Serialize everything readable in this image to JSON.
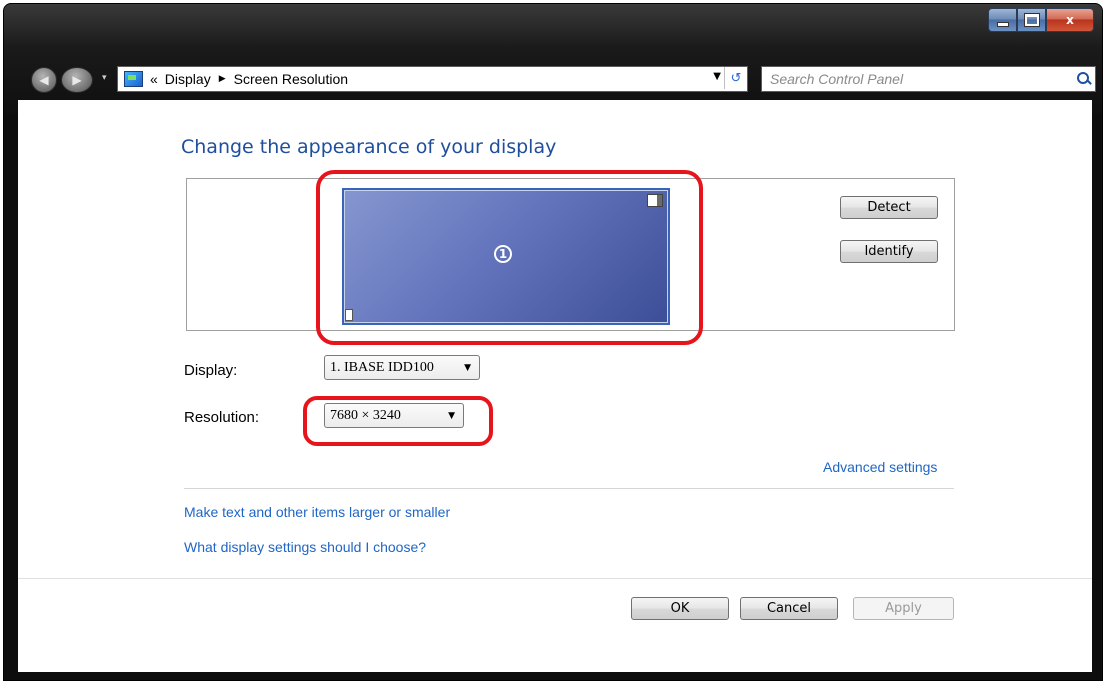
{
  "window": {
    "caption_buttons": {
      "minimize": "minimize-icon",
      "maximize": "maximize-icon",
      "close": "x"
    }
  },
  "nav": {
    "back": "◀",
    "forward": "▶",
    "recent": "▾"
  },
  "address": {
    "overflow": "«",
    "crumbs": [
      "Display",
      "Screen Resolution"
    ],
    "separator": "▶",
    "dropdown": "▼",
    "refresh": "↺"
  },
  "search": {
    "placeholder": "Search Control Panel"
  },
  "main": {
    "heading": "Change the appearance of your display",
    "monitor": {
      "number": "1"
    },
    "detect_label": "Detect",
    "identify_label": "Identify",
    "display_label": "Display:",
    "display_value": "1. IBASE IDD100",
    "resolution_label": "Resolution:",
    "resolution_value": "7680 × 3240",
    "combo_arrow": "▼",
    "advanced_settings": "Advanced settings",
    "link_text_size": "Make text and other items larger or smaller",
    "link_choose": "What display settings should I choose?"
  },
  "footer": {
    "ok_label": "OK",
    "cancel_label": "Cancel",
    "apply_label": "Apply"
  },
  "colors": {
    "link": "#1f66c5",
    "heading": "#1e4e9c",
    "highlight": "#e8141b",
    "monitor_fill": "#6475bd"
  }
}
